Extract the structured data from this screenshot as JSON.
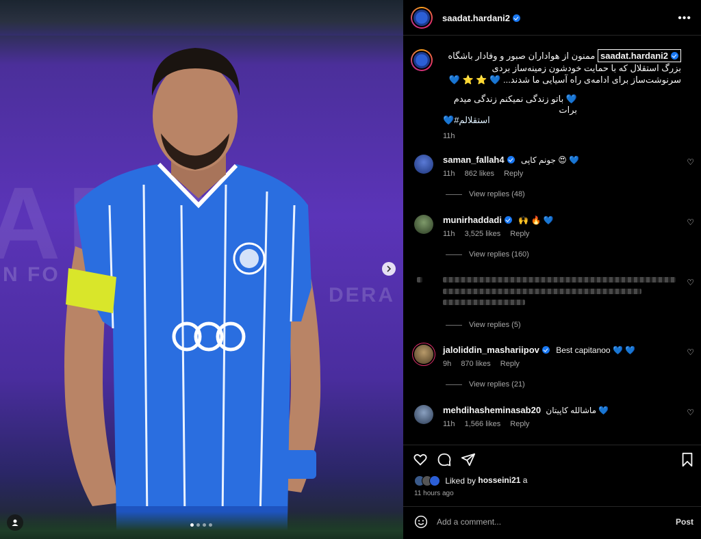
{
  "post": {
    "username": "saadat.hardani2",
    "carousel_dots": 4,
    "active_dot": 0
  },
  "caption": {
    "username": "saadat.hardani2",
    "text": "ممنون از هواداران صبور و وفادار باشگاه بزرگ استقلال که با حمایت خودشون زمینه‌ساز بردی سرنوشت‌ساز برای ادامه‌ی راه آسیایی ما شدند... 💙 ⭐ ⭐ 💙",
    "line2": "💙 باتو زندگی نمیکنم زندگی میدم برات",
    "hashtag": "#استقلالم",
    "hashtag_emoji": "💙",
    "time": "11h"
  },
  "comments": [
    {
      "username": "saman_fallah4",
      "verified": true,
      "text": "جونم کاپی 😍 💙",
      "time": "11h",
      "likes": "862 likes",
      "reply": "Reply",
      "view_replies": "View replies (48)",
      "avatar_color": "#2c4fa8"
    },
    {
      "username": "munirhaddadi",
      "verified": true,
      "text": "🙌 🔥 💙",
      "time": "11h",
      "likes": "3,525 likes",
      "reply": "Reply",
      "view_replies": "View replies (160)",
      "avatar_color": "#3a5a3a"
    },
    {
      "username": "",
      "verified": false,
      "text": "",
      "time": "",
      "likes": "",
      "reply": "",
      "view_replies": "View replies (5)",
      "avatar_color": "#000"
    },
    {
      "username": "jaloliddin_mashariipov",
      "verified": true,
      "text": "Best capitanoo 💙 💙",
      "time": "9h",
      "likes": "870 likes",
      "reply": "Reply",
      "view_replies": "View replies (21)",
      "avatar_color": "#7a6a4a"
    },
    {
      "username": "mehdihasheminasab20",
      "verified": false,
      "text": "ماشالله کاپیتان 💙",
      "time": "11h",
      "likes": "1,566 likes",
      "reply": "Reply",
      "view_replies": "",
      "avatar_color": "#4a5a70"
    }
  ],
  "footer": {
    "liked_by_prefix": "Liked by",
    "liked_by_user": "hosseini21",
    "liked_by_suffix": "a",
    "time_ago": "11 hours ago",
    "add_comment_placeholder": "Add a comment...",
    "post_label": "Post"
  },
  "colors": {
    "panel_bg": "#000000",
    "verified": "#1877f2",
    "muted": "#a8a8a8",
    "photo_purple": "#5b34b8",
    "jersey_blue": "#2a6ee0"
  },
  "icons": [
    "more-icon",
    "verified-icon",
    "heart-icon",
    "comment-icon",
    "share-icon",
    "bookmark-icon",
    "emoji-icon",
    "next-arrow-icon",
    "tag-user-icon"
  ]
}
